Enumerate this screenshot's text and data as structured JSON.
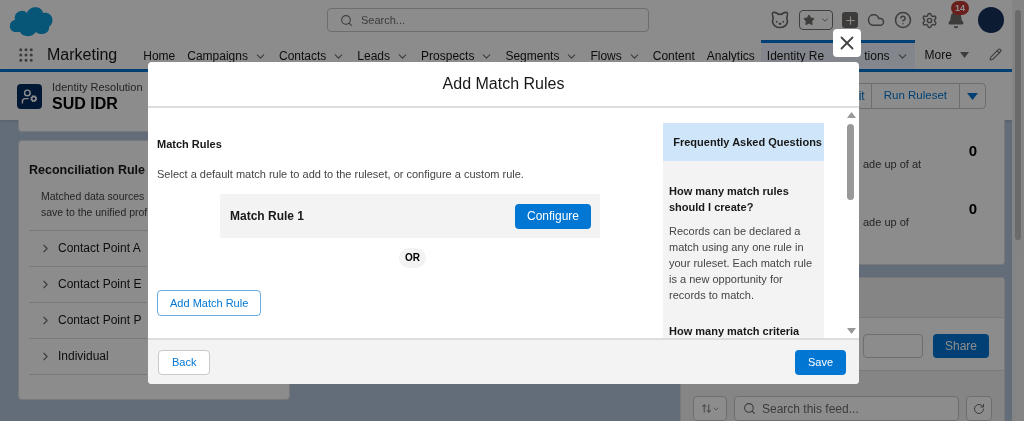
{
  "header": {
    "search_placeholder": "Search...",
    "notification_count": "14"
  },
  "nav": {
    "app_name": "Marketing",
    "tabs": [
      {
        "label": "Home",
        "dropdown": false,
        "selected": false
      },
      {
        "label": "Campaigns",
        "dropdown": true,
        "selected": false
      },
      {
        "label": "Contacts",
        "dropdown": true,
        "selected": false
      },
      {
        "label": "Leads",
        "dropdown": true,
        "selected": false
      },
      {
        "label": "Prospects",
        "dropdown": true,
        "selected": false
      },
      {
        "label": "Segments",
        "dropdown": true,
        "selected": false
      },
      {
        "label": "Flows",
        "dropdown": true,
        "selected": false
      },
      {
        "label": "Content",
        "dropdown": false,
        "selected": false
      },
      {
        "label": "Analytics",
        "dropdown": false,
        "selected": false
      },
      {
        "label": "Identity Re",
        "label_tail": "tions",
        "dropdown": true,
        "selected": true
      }
    ],
    "more": "More"
  },
  "record": {
    "type": "Identity Resolution",
    "name": "SUD IDR",
    "buttons": [
      "it",
      "Run Ruleset"
    ]
  },
  "reconciliation": {
    "title": "Reconciliation Rule",
    "description": [
      "Matched data sources",
      "save to the unified prof"
    ],
    "items": [
      "Contact Point A",
      "Contact Point E",
      "Contact Point P",
      "Individual"
    ]
  },
  "stats": [
    {
      "text": "ade up of at",
      "value": "0"
    },
    {
      "text": "ade up of",
      "value": "0"
    }
  ],
  "feed": {
    "share": "Share",
    "search_placeholder": "Search this feed..."
  },
  "modal": {
    "title": "Add Match Rules",
    "section_title": "Match Rules",
    "description": "Select a default match rule to add to the ruleset, or configure a custom rule.",
    "rules": [
      {
        "name": "Match Rule 1",
        "action": "Configure"
      }
    ],
    "separator": "OR",
    "add_button": "Add Match Rule",
    "faq": {
      "title": "Frequently Asked Questions",
      "items": [
        {
          "question": "How many match rules should I create?",
          "answer": "Records can be declared a match using any one rule in your ruleset. Each match rule is a new opportunity for records to match."
        },
        {
          "question": "How many match criteria"
        }
      ]
    },
    "back": "Back",
    "save": "Save"
  }
}
